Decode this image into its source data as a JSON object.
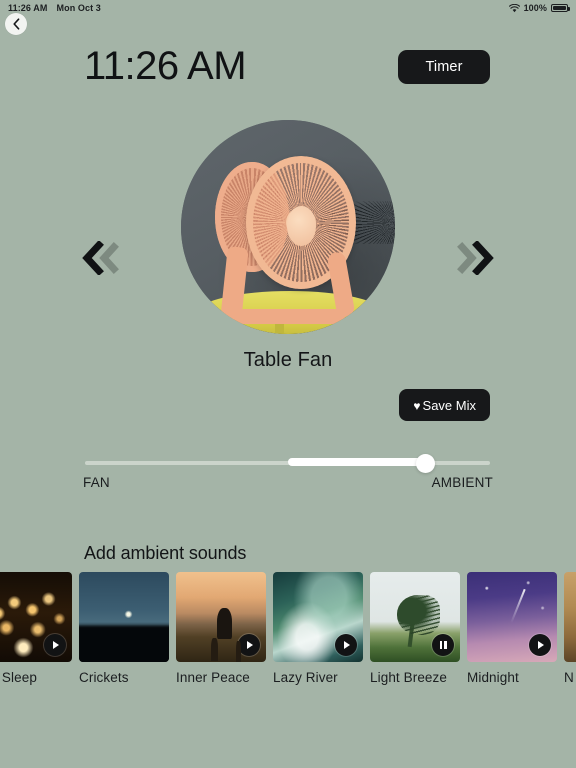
{
  "statusbar": {
    "time": "11:26 AM",
    "date": "Mon Oct 3",
    "battery_pct": "100%",
    "wifi_icon": "wifi-icon",
    "battery_icon": "battery-full-icon"
  },
  "nav": {
    "back_icon": "chevron-left-icon"
  },
  "header": {
    "clock": "11:26 AM",
    "timer_label": "Timer"
  },
  "player": {
    "sound_title": "Table Fan",
    "artwork_alt": "table-fan-artwork",
    "prev_icon": "chevron-double-left-icon",
    "next_icon": "chevron-double-right-icon",
    "save_mix_label": "Save Mix",
    "save_mix_icon": "♥"
  },
  "slider": {
    "min_label": "FAN",
    "max_label": "AMBIENT",
    "value_pct": 84,
    "fill_start_pct": 50,
    "track_color": "#cbd4cb",
    "fill_color": "#ffffff"
  },
  "ambient": {
    "heading": "Add ambient sounds",
    "cards": [
      {
        "label": "ter Sleep",
        "full_label": "Winter Sleep",
        "state": "play",
        "scene": "sc-candles",
        "partial": true
      },
      {
        "label": "Crickets",
        "full_label": "Crickets",
        "state": "play",
        "scene": "sc-crickets",
        "partial": false
      },
      {
        "label": "Inner Peace",
        "full_label": "Inner Peace",
        "state": "play",
        "scene": "sc-peace",
        "partial": false
      },
      {
        "label": "Lazy River",
        "full_label": "Lazy River",
        "state": "play",
        "scene": "sc-river",
        "partial": false
      },
      {
        "label": "Light Breeze",
        "full_label": "Light Breeze",
        "state": "pause",
        "scene": "sc-breeze",
        "partial": false
      },
      {
        "label": "Midnight",
        "full_label": "Midnight",
        "state": "play",
        "scene": "sc-midnight",
        "partial": false
      },
      {
        "label": "N",
        "full_label": "N",
        "state": "none",
        "scene": "sc-partial",
        "partial": true
      }
    ]
  },
  "colors": {
    "background": "#a4b4a7",
    "button_dark": "#17181a",
    "text_primary": "#16181a"
  }
}
